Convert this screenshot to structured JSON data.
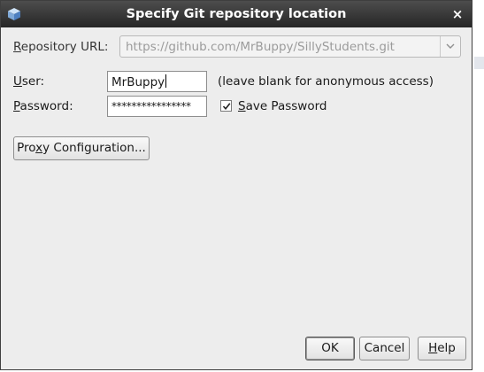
{
  "dialog": {
    "title": "Specify Git repository location",
    "close_glyph": "×",
    "app_icon": "cube-icon"
  },
  "repository_url": {
    "label_first": "R",
    "label_rest": "epository URL:",
    "value": "https://github.com/MrBuppy/SillyStudents.git",
    "dropdown_icon": "chevron-down-icon"
  },
  "user": {
    "label_first": "U",
    "label_rest": "ser:",
    "value": "MrBuppy",
    "hint": "(leave blank for anonymous access)"
  },
  "password": {
    "label_first": "P",
    "label_rest": "assword:",
    "masked_value": "****************",
    "save_label_first": "S",
    "save_label_rest": "ave Password",
    "save_checked": true
  },
  "buttons": {
    "proxy_pre": "Pro",
    "proxy_mnemonic": "x",
    "proxy_post": "y Configuration...",
    "ok": "OK",
    "cancel": "Cancel",
    "help_first": "H",
    "help_rest": "elp"
  }
}
